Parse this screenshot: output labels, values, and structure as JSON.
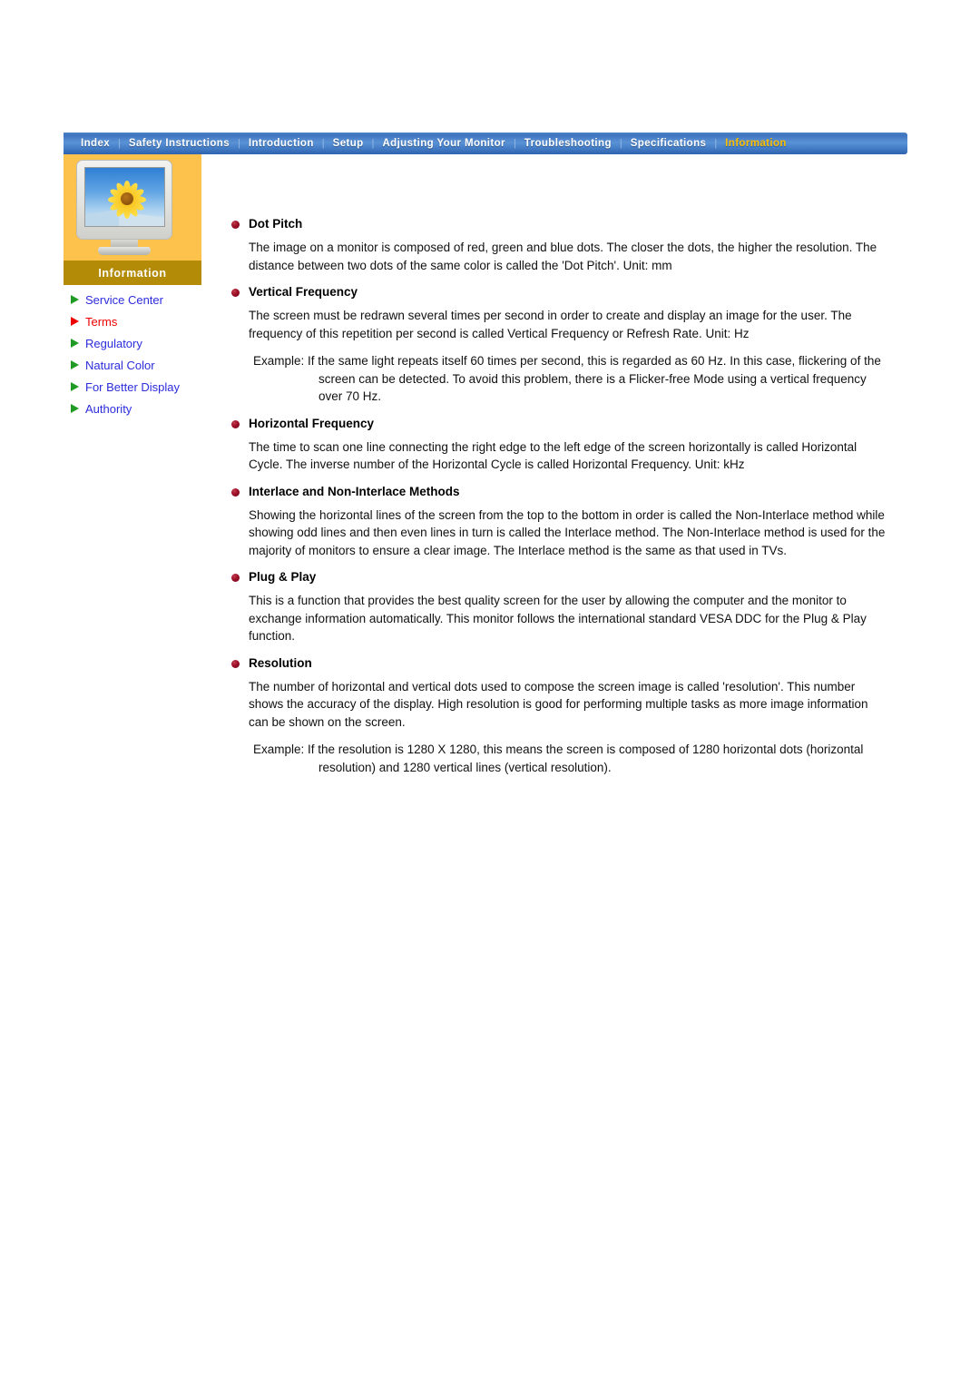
{
  "nav": {
    "separator": "|",
    "items": [
      {
        "label": "Index",
        "active": false
      },
      {
        "label": "Safety Instructions",
        "active": false
      },
      {
        "label": "Introduction",
        "active": false
      },
      {
        "label": "Setup",
        "active": false
      },
      {
        "label": "Adjusting Your Monitor",
        "active": false
      },
      {
        "label": "Troubleshooting",
        "active": false
      },
      {
        "label": "Specifications",
        "active": false
      },
      {
        "label": "Information",
        "active": true
      }
    ]
  },
  "sidebar": {
    "caption": "Information",
    "colors": {
      "panel": "#fcc24c",
      "caption_band": "#b38b06",
      "link": "#2c2cdd",
      "active_link": "#ee0000",
      "marker": "#1f9b23",
      "active_marker": "#ee0000"
    },
    "items": [
      {
        "label": "Service Center",
        "active": false
      },
      {
        "label": "Terms",
        "active": true
      },
      {
        "label": "Regulatory",
        "active": false
      },
      {
        "label": "Natural Color",
        "active": false
      },
      {
        "label": "For Better Display",
        "active": false
      },
      {
        "label": "Authority",
        "active": false
      }
    ]
  },
  "content": {
    "bullet_color": "#9c1028",
    "sections": [
      {
        "title": "Dot Pitch",
        "body": "The image on a monitor is composed of red, green and blue dots. The closer the dots, the higher the resolution. The distance between two dots of the same color is called the 'Dot Pitch'. Unit: mm",
        "example": ""
      },
      {
        "title": "Vertical Frequency",
        "body": "The screen must be redrawn several times per second in order to create and display an image for the user. The frequency of this repetition per second is called Vertical Frequency or Refresh Rate. Unit: Hz",
        "example": "Example: If the same light repeats itself 60 times per second, this is regarded as 60 Hz. In this case, flickering of the screen can be detected. To avoid this problem, there is a Flicker-free Mode using a vertical frequency over 70 Hz."
      },
      {
        "title": "Horizontal Frequency",
        "body": "The time to scan one line connecting the right edge to the left edge of the screen horizontally is called Horizontal Cycle. The inverse number of the Horizontal Cycle is called Horizontal Frequency. Unit: kHz",
        "example": ""
      },
      {
        "title": "Interlace and Non-Interlace Methods",
        "body": "Showing the horizontal lines of the screen from the top to the bottom in order is called the Non-Interlace method while showing odd lines and then even lines in turn is called the Interlace method. The Non-Interlace method is used for the majority of monitors to ensure a clear image. The Interlace method is the same as that used in TVs.",
        "example": ""
      },
      {
        "title": "Plug & Play",
        "body": "This is a function that provides the best quality screen for the user by allowing the computer and the monitor to exchange information automatically. This monitor follows the international standard VESA DDC for the Plug & Play function.",
        "example": ""
      },
      {
        "title": "Resolution",
        "body": "The number of horizontal and vertical dots used to compose the screen image is called 'resolution'. This number shows the accuracy of the display. High resolution is good for performing multiple tasks as more image information can be shown on the screen.",
        "example": "Example: If the resolution is 1280 X 1280, this means the screen is composed of 1280 horizontal dots (horizontal resolution) and 1280 vertical lines (vertical resolution)."
      }
    ]
  }
}
